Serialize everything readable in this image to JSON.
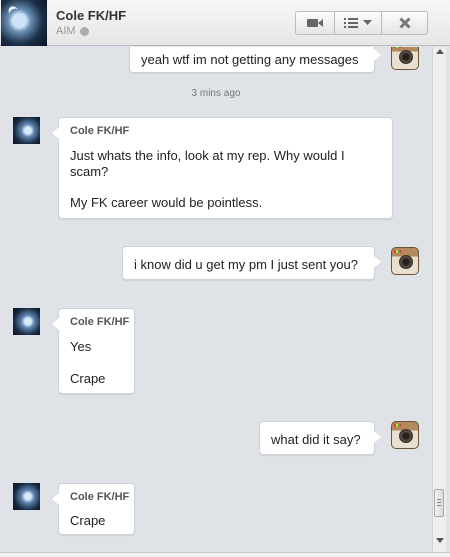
{
  "header": {
    "contact_name": "Cole FK/HF",
    "service": "AIM",
    "buttons": {
      "video": "video-camera-icon",
      "menu": "list-menu-icon",
      "close": "close-icon"
    }
  },
  "messages": [
    {
      "direction": "out",
      "lines": [
        "yeah wtf im not getting any messages"
      ]
    },
    {
      "timestamp": "3 mins ago"
    },
    {
      "direction": "in",
      "sender": "Cole FK/HF",
      "lines": [
        "Just whats the info, look at my rep. Why would I",
        "scam?",
        "My FK career would be pointless."
      ]
    },
    {
      "direction": "out",
      "lines": [
        "i know did u get my pm I just sent you?"
      ]
    },
    {
      "direction": "in",
      "sender": "Cole FK/HF",
      "lines": [
        "Yes",
        "Crape"
      ]
    },
    {
      "direction": "out",
      "lines": [
        "what did it say?"
      ]
    },
    {
      "direction": "in",
      "sender": "Cole FK/HF",
      "lines": [
        "Crape"
      ]
    }
  ],
  "colors": {
    "background": "#dfe3e8",
    "bubble": "#ffffff",
    "header": "#eeeeee"
  }
}
